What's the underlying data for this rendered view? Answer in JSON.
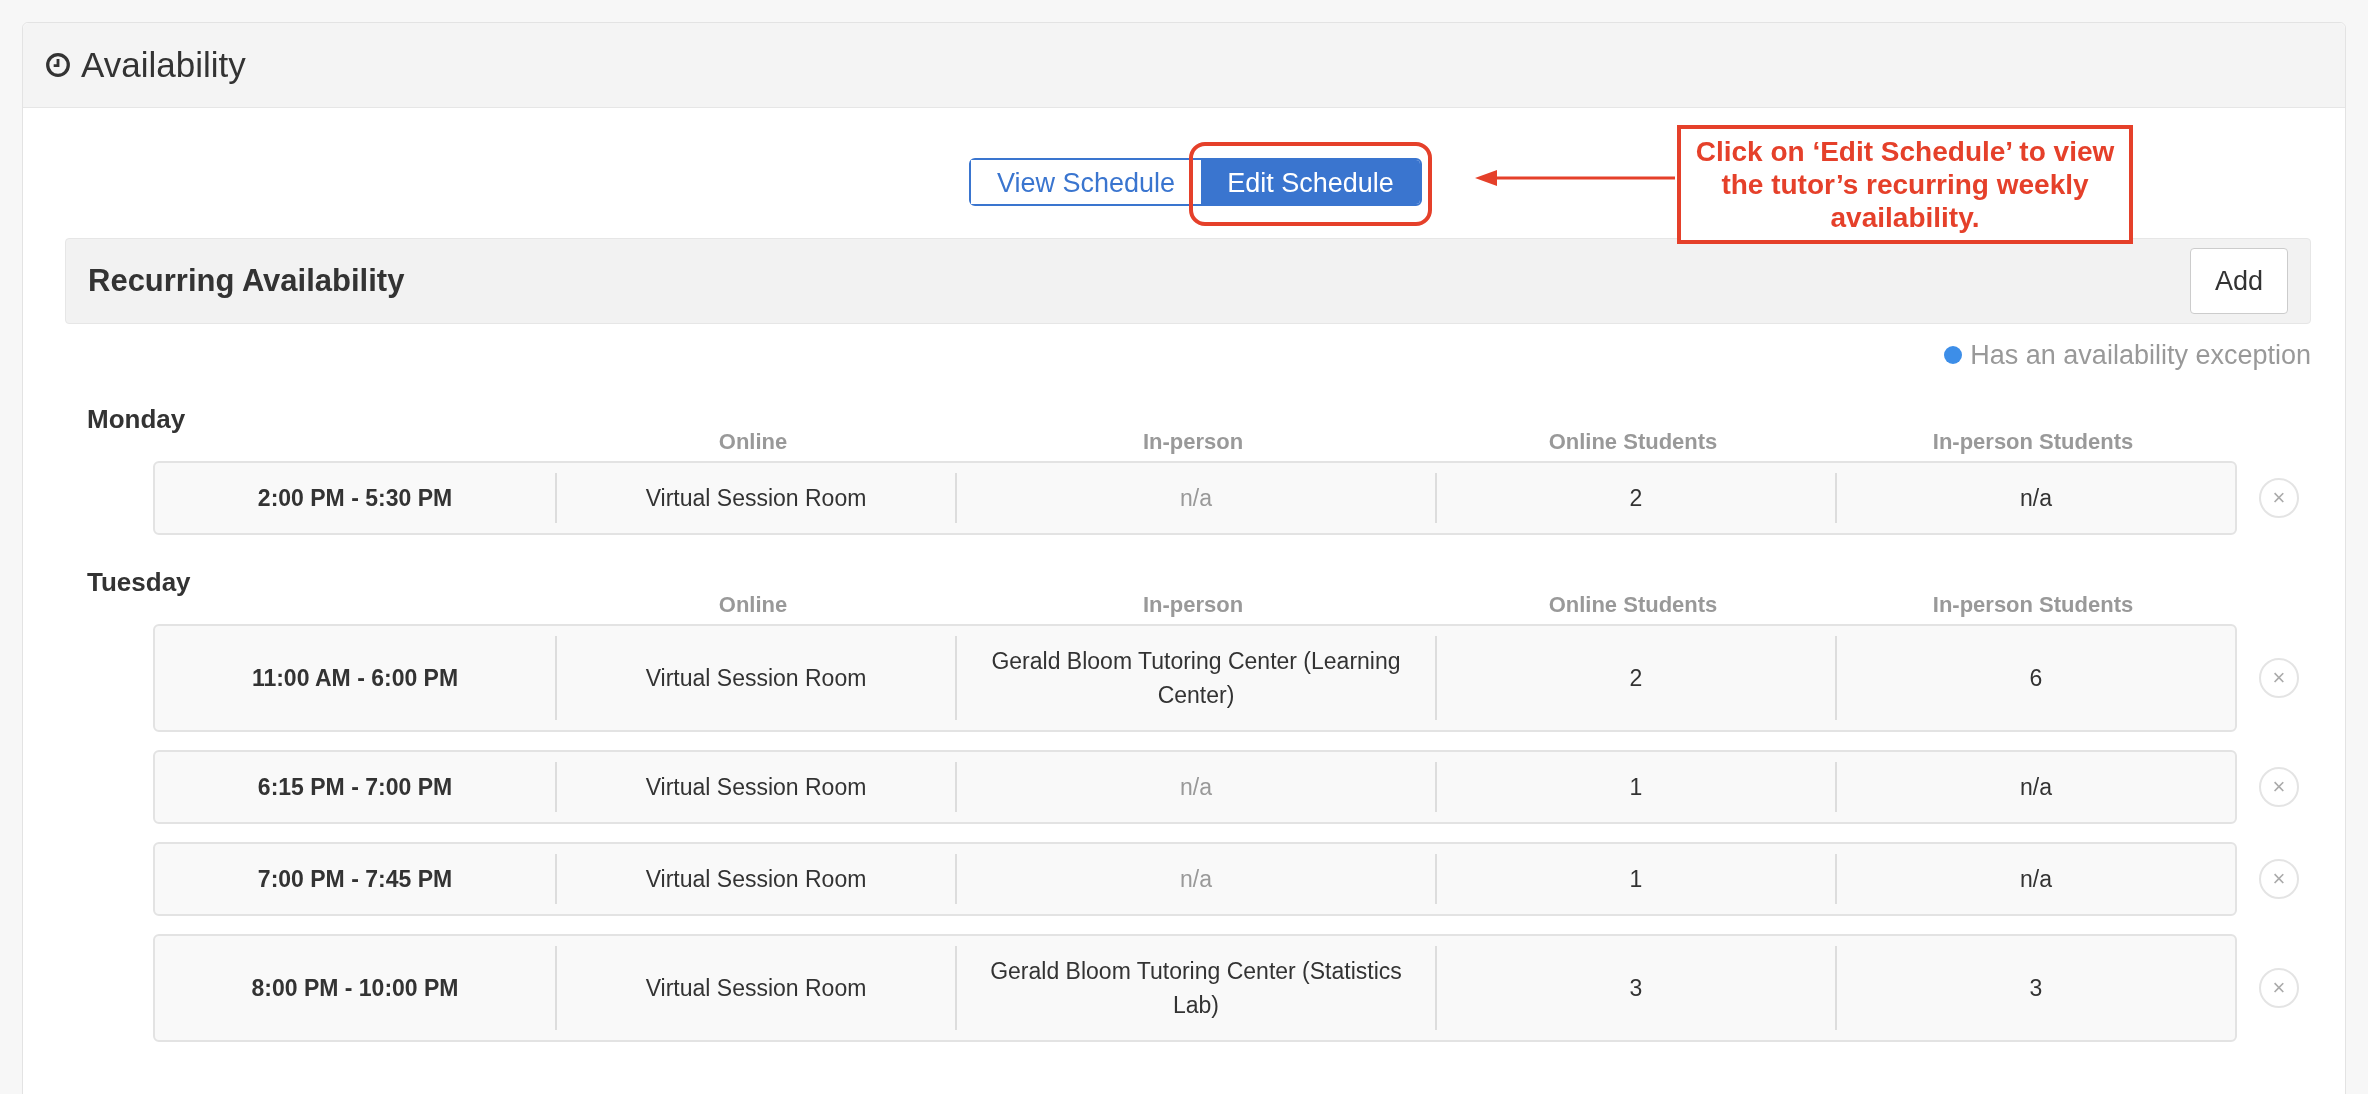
{
  "panel": {
    "title": "Availability"
  },
  "view_toggle": [
    {
      "label": "View Schedule",
      "selected": false
    },
    {
      "label": "Edit Schedule",
      "selected": true
    }
  ],
  "callout": {
    "text": "Click on ‘Edit Schedule’ to view the tutor’s recurring weekly availability."
  },
  "section": {
    "title": "Recurring Availability",
    "add_button": "Add"
  },
  "legend": {
    "text": "Has an availability exception",
    "color": "#3d8ee8"
  },
  "days": [
    {
      "name": "Monday",
      "columns": [
        "Online",
        "In-person",
        "Online Students",
        "In-person Students"
      ],
      "rows": [
        {
          "time": "2:00 PM - 5:30 PM",
          "online": "Virtual Session Room",
          "in_person": {
            "text": "n/a",
            "muted": true
          },
          "online_students": "2",
          "in_person_students": "n/a",
          "close": "×"
        }
      ]
    },
    {
      "name": "Tuesday",
      "columns": [
        "Online",
        "In-person",
        "Online Students",
        "In-person Students"
      ],
      "rows": [
        {
          "time": "11:00 AM - 6:00 PM",
          "online": "Virtual Session Room",
          "in_person": {
            "text": "Gerald Bloom Tutoring Center (Learning Center)",
            "muted": false
          },
          "online_students": "2",
          "in_person_students": "6",
          "close": "×"
        },
        {
          "time": "6:15 PM - 7:00 PM",
          "online": "Virtual Session Room",
          "in_person": {
            "text": "n/a",
            "muted": true
          },
          "online_students": "1",
          "in_person_students": "n/a",
          "close": "×"
        },
        {
          "time": "7:00 PM - 7:45 PM",
          "online": "Virtual Session Room",
          "in_person": {
            "text": "n/a",
            "muted": true
          },
          "online_students": "1",
          "in_person_students": "n/a",
          "close": "×"
        },
        {
          "time": "8:00 PM - 10:00 PM",
          "online": "Virtual Session Room",
          "in_person": {
            "text": "Gerald Bloom Tutoring Center (Statistics Lab)",
            "muted": false
          },
          "online_students": "3",
          "in_person_students": "3",
          "close": "×"
        }
      ]
    }
  ]
}
